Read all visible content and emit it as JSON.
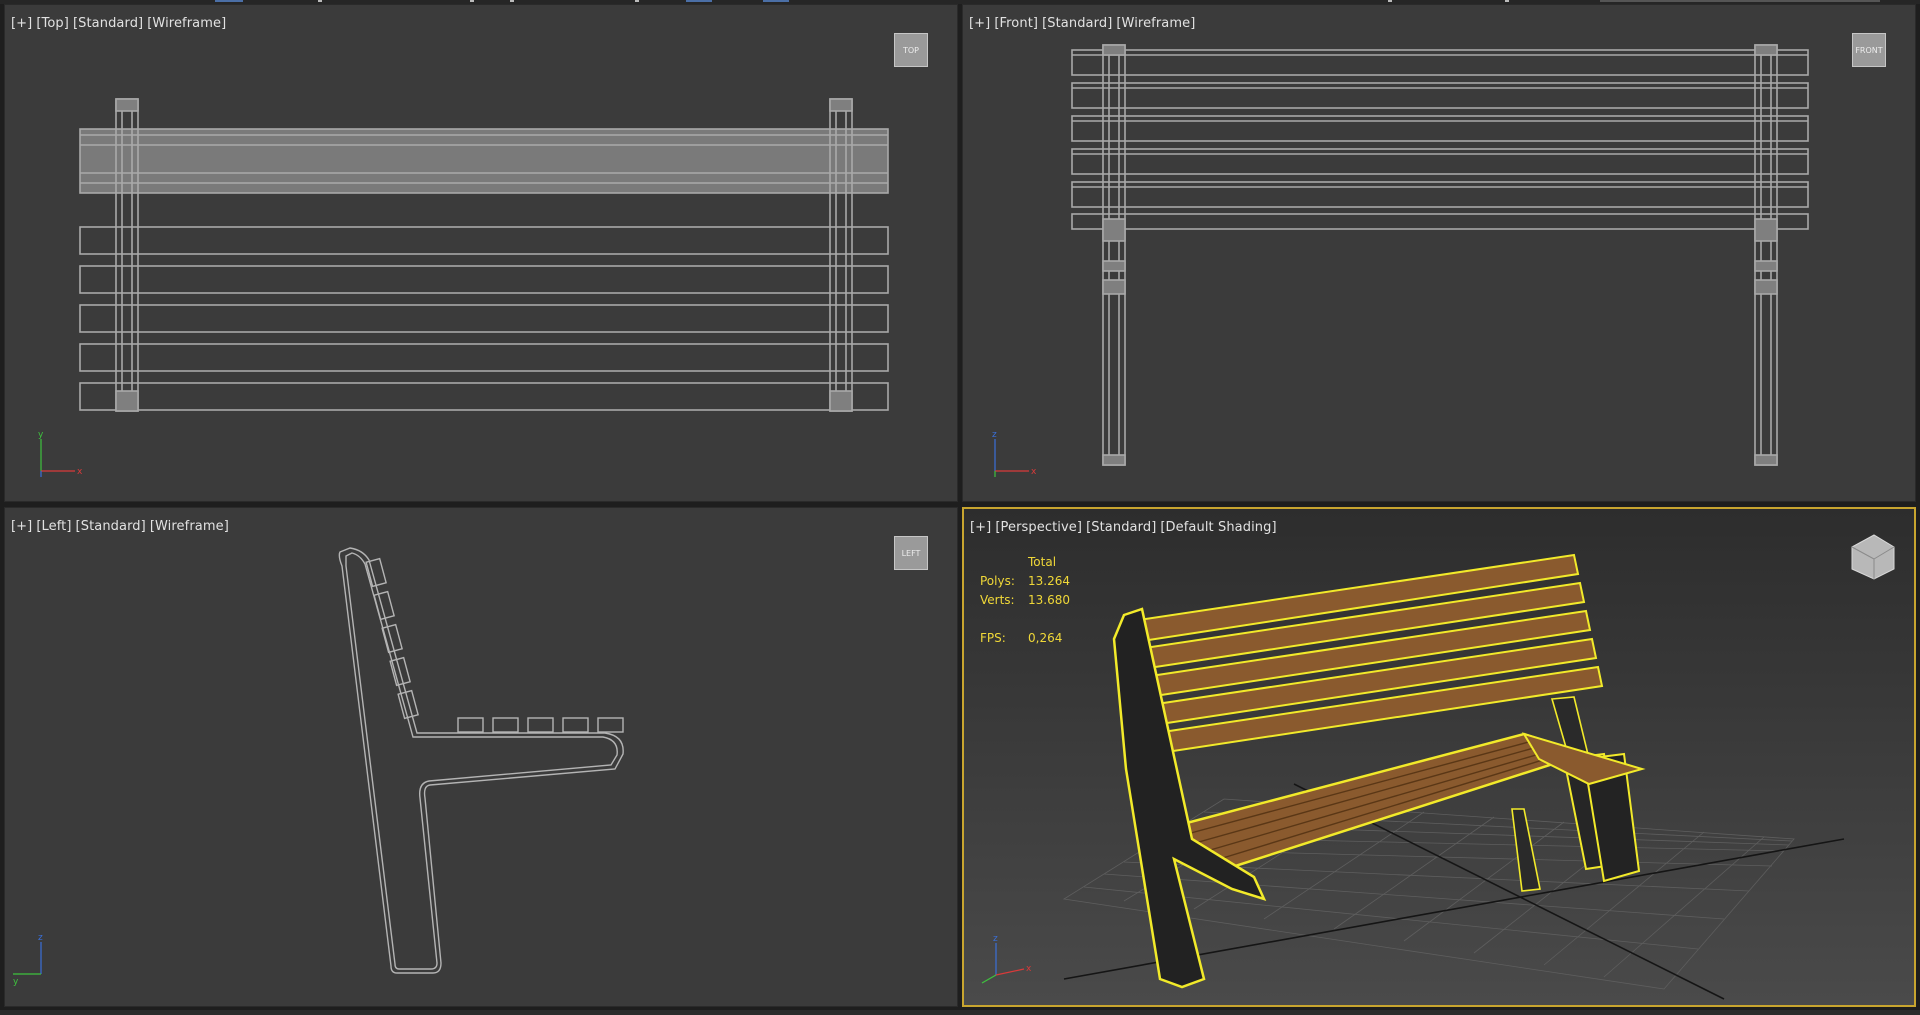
{
  "viewports": {
    "top": {
      "label": [
        "[+]",
        "[Top]",
        "[Standard]",
        "[Wireframe]"
      ],
      "cube": "TOP"
    },
    "front": {
      "label": [
        "[+]",
        "[Front]",
        "[Standard]",
        "[Wireframe]"
      ],
      "cube": "FRONT"
    },
    "left": {
      "label": [
        "[+]",
        "[Left]",
        "[Standard]",
        "[Wireframe]"
      ],
      "cube": "LEFT"
    },
    "perspective": {
      "label": [
        "[+]",
        "[Perspective]",
        "[Standard]",
        "[Default Shading]"
      ],
      "stats": {
        "header": "Total",
        "polys_label": "Polys:",
        "polys": "13.264",
        "verts_label": "Verts:",
        "verts": "13.680",
        "fps_label": "FPS:",
        "fps": "0,264"
      }
    }
  },
  "colors": {
    "viewport_bg": "#3b3b3b",
    "active_border": "#c8a52f",
    "wire": "#a9a9a9",
    "selection": "#f2ea2a",
    "wood": "#8a5a2e",
    "metal": "#2a2a2a",
    "stats_text": "#f0d838"
  },
  "icons": {
    "axis_tripod": "axis-tripod-icon",
    "viewcube": "viewcube-icon"
  }
}
